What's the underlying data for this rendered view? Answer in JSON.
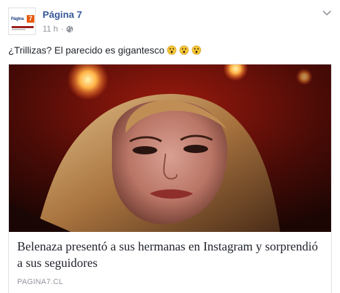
{
  "post": {
    "page_name": "Página 7",
    "timestamp": "11 h",
    "separator": "·",
    "avatar_text": "Página",
    "avatar_badge": "7",
    "caption": "¿Trillizas? El parecido es gigantesco",
    "emoji_count": 3,
    "icons": {
      "privacy": "globe-icon",
      "options": "chevron-down-icon",
      "emoji": "astonished-face-emoji"
    }
  },
  "link_card": {
    "title": "Belenaza presentó a sus hermanas en Instagram y sorprendió a sus seguidores",
    "domain": "PAGINA7.CL"
  },
  "colors": {
    "link_blue": "#365899",
    "meta_gray": "#90949c",
    "text": "#1d2129",
    "border": "#dddfe2"
  }
}
